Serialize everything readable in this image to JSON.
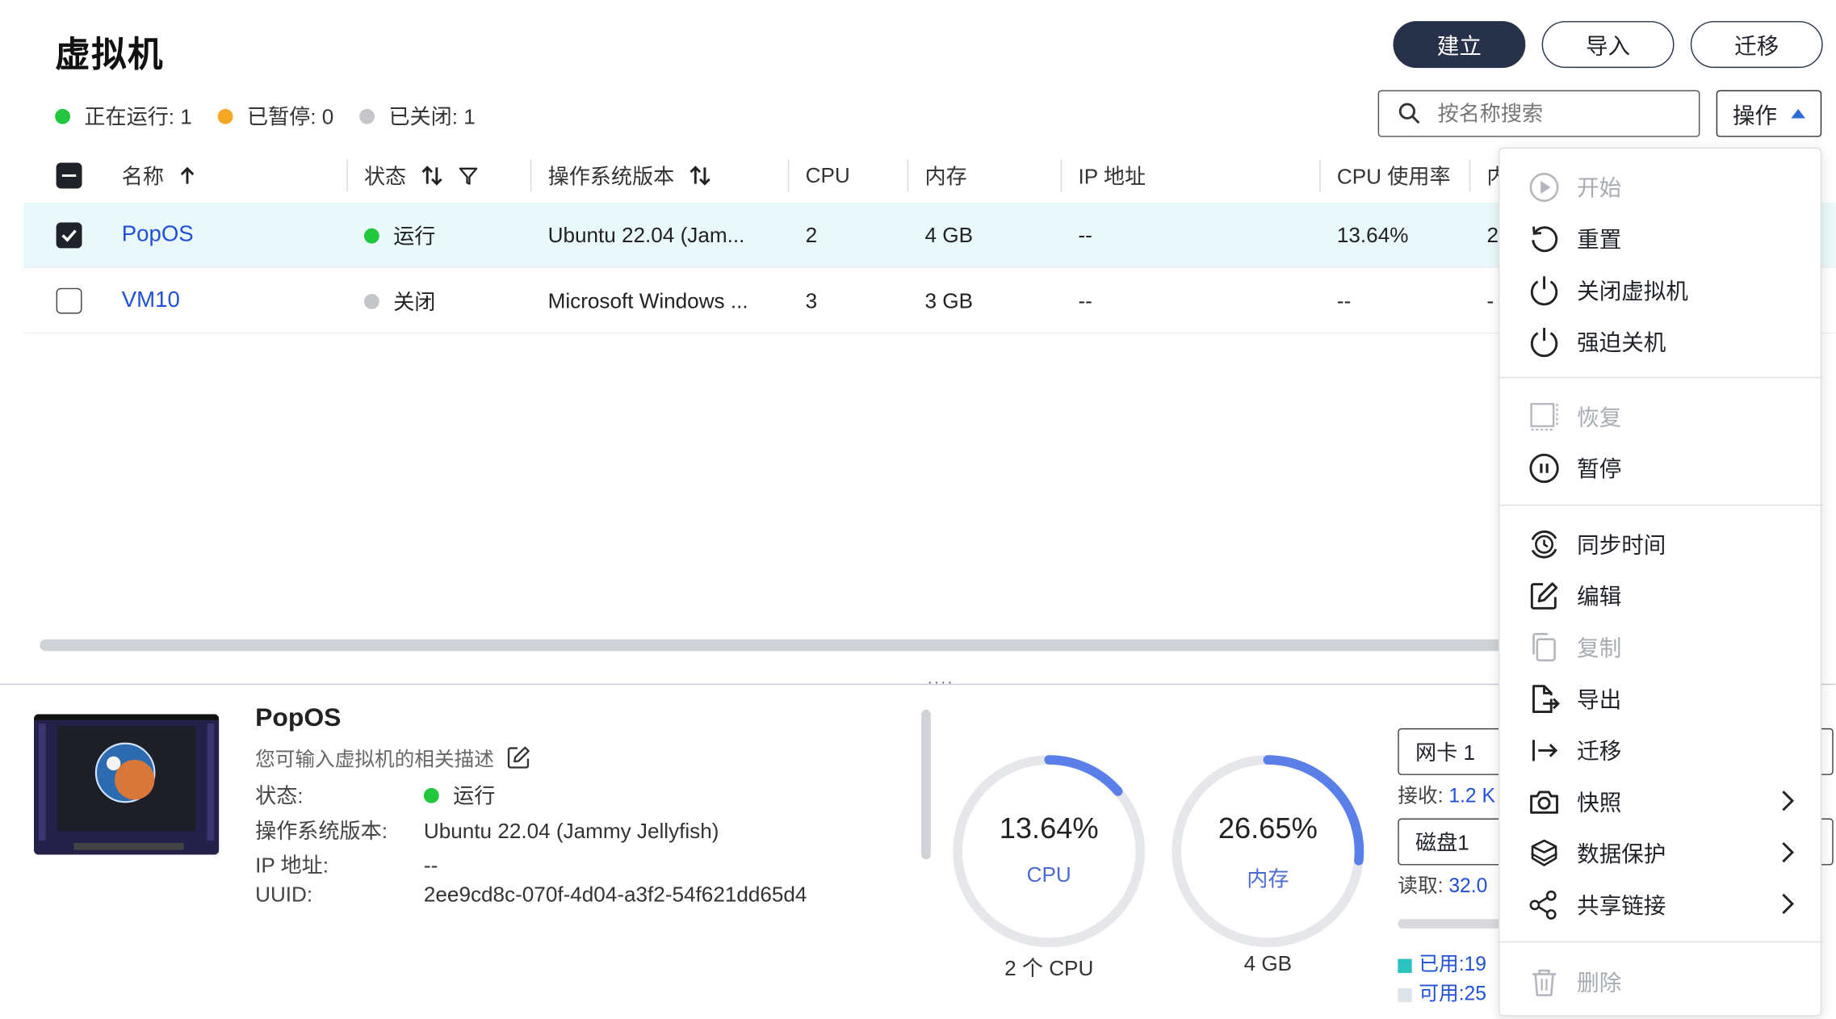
{
  "page": {
    "title": "虚拟机"
  },
  "toolbar": {
    "create_label": "建立",
    "import_label": "导入",
    "migrate_label": "迁移"
  },
  "summary": [
    {
      "label": "正在运行: 1",
      "color": "#22c73e"
    },
    {
      "label": "已暂停: 0",
      "color": "#f5a623"
    },
    {
      "label": "已关闭: 1",
      "color": "#c4c6c9"
    }
  ],
  "search": {
    "placeholder": "按名称搜索"
  },
  "ops": {
    "label": "操作"
  },
  "table": {
    "columns": [
      "名称",
      "状态",
      "操作系统版本",
      "CPU",
      "内存",
      "IP 地址",
      "CPU 使用率",
      "内"
    ],
    "rows": [
      {
        "name": "PopOS",
        "status": "运行",
        "status_color": "#22c73e",
        "os": "Ubuntu 22.04 (Jam...",
        "cpu": "2",
        "memory": "4 GB",
        "ip": "--",
        "cpu_usage": "13.64%",
        "extra": "2",
        "checked": true
      },
      {
        "name": "VM10",
        "status": "关闭",
        "status_color": "#c4c6c9",
        "os": "Microsoft Windows ...",
        "cpu": "3",
        "memory": "3 GB",
        "ip": "--",
        "cpu_usage": "--",
        "extra": "-",
        "checked": false
      }
    ]
  },
  "details": {
    "name": "PopOS",
    "description": "您可输入虚拟机的相关描述",
    "status_key": "状态:",
    "status_value": "运行",
    "os_key": "操作系统版本:",
    "os_value": "Ubuntu 22.04 (Jammy Jellyfish)",
    "ip_key": "IP 地址:",
    "ip_value": "--",
    "uuid_key": "UUID:",
    "uuid_value": "2ee9cd8c-070f-4d04-a3f2-54f621dd65d4"
  },
  "gauges": {
    "cpu": {
      "value": "13.64%",
      "label": "CPU",
      "sub": "2 个 CPU",
      "fraction": 0.1364
    },
    "memory": {
      "value": "26.65%",
      "label": "内存",
      "sub": "4 GB",
      "fraction": 0.2665
    }
  },
  "side_panel": {
    "nic_label": "网卡 1",
    "receive": "接收:",
    "receive_value": "1.2 K",
    "disk_label": "磁盘1",
    "read": "读取:",
    "read_value": "32.0",
    "used": "已用:19",
    "available": "可用:25"
  },
  "menu": {
    "items": [
      {
        "label": "开始",
        "icon": "play-icon",
        "disabled": true
      },
      {
        "label": "重置",
        "icon": "reset-icon",
        "disabled": false
      },
      {
        "label": "关闭虚拟机",
        "icon": "power-icon",
        "disabled": false
      },
      {
        "label": "强迫关机",
        "icon": "force-power-icon",
        "disabled": false
      },
      {
        "label": "恢复",
        "icon": "resume-icon",
        "disabled": true
      },
      {
        "label": "暂停",
        "icon": "pause-icon",
        "disabled": false
      },
      {
        "label": "同步时间",
        "icon": "sync-time-icon",
        "disabled": false
      },
      {
        "label": "编辑",
        "icon": "edit-icon",
        "disabled": false
      },
      {
        "label": "复制",
        "icon": "copy-icon",
        "disabled": true
      },
      {
        "label": "导出",
        "icon": "export-icon",
        "disabled": false
      },
      {
        "label": "迁移",
        "icon": "migrate-icon",
        "disabled": false
      },
      {
        "label": "快照",
        "icon": "camera-icon",
        "disabled": false,
        "submenu": true
      },
      {
        "label": "数据保护",
        "icon": "data-protection-icon",
        "disabled": false,
        "submenu": true
      },
      {
        "label": "共享链接",
        "icon": "share-icon",
        "disabled": false,
        "submenu": true
      },
      {
        "label": "删除",
        "icon": "trash-icon",
        "disabled": true
      }
    ]
  },
  "colors": {
    "accent": "#1f50d6",
    "primary_button": "#27324a",
    "gauge_arc": "#5b7fe8",
    "gauge_track": "#e6e7ea",
    "selected_row": "#e8f8fb"
  }
}
